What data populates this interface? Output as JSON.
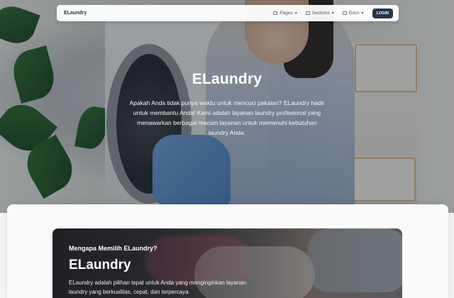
{
  "navbar": {
    "brand": "ELaundry",
    "items": [
      {
        "label": "Pages",
        "icon": "pages-icon"
      },
      {
        "label": "Sections",
        "icon": "sections-icon"
      },
      {
        "label": "Docs",
        "icon": "docs-icon"
      }
    ],
    "login_label": "LOGIN"
  },
  "hero": {
    "title": "ELaundry",
    "text": "Apakah Anda tidak punya waktu untuk mencuci pakaian? ELaundry hadir untuk membantu Anda! Kami adalah layanan laundry profesional yang menawarkan berbagai macam layanan untuk memenuhi kebutuhan laundry Anda."
  },
  "feature": {
    "kicker": "Mengapa Memilih ELaundry?",
    "title": "ELaundry",
    "text": "ELaundry adalah pilihan tepat untuk Anda yang menginginkan layanan laundry yang berkualitas, cepat, dan terpercaya."
  },
  "colors": {
    "login_bg": "#253648",
    "hero_overlay": "#1c2631"
  }
}
